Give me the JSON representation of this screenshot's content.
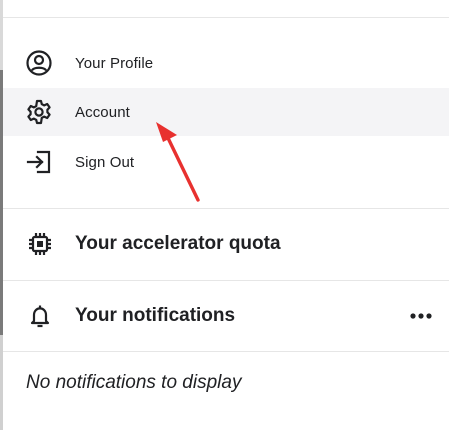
{
  "menu": {
    "items": [
      {
        "label": "Your Profile",
        "icon": "account-circle-icon"
      },
      {
        "label": "Account",
        "icon": "gear-icon"
      },
      {
        "label": "Sign Out",
        "icon": "sign-out-icon"
      }
    ]
  },
  "quota": {
    "title": "Your accelerator quota",
    "icon": "chip-icon"
  },
  "notifications": {
    "title": "Your notifications",
    "icon": "bell-icon",
    "more_icon": "more-horizontal-icon",
    "empty_text": "No notifications to display"
  },
  "colors": {
    "text": "#202124",
    "divider": "#e6e6e6",
    "hover_bg": "#f4f4f6",
    "arrow": "#e8312f"
  }
}
